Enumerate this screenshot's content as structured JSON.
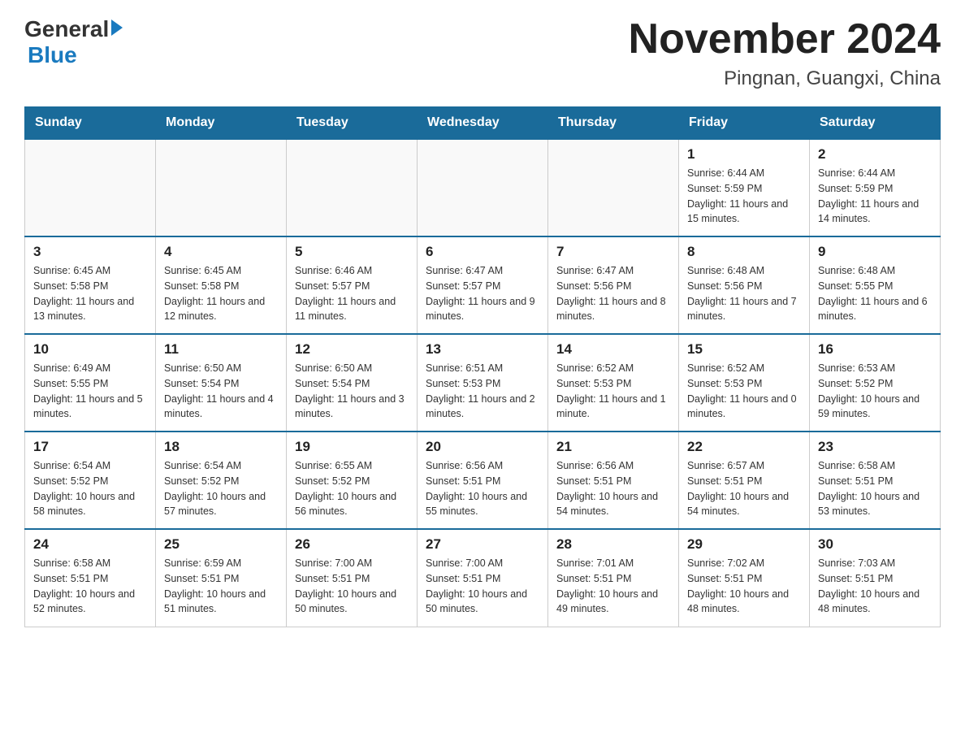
{
  "logo": {
    "text_general": "General",
    "text_blue": "Blue"
  },
  "title": "November 2024",
  "subtitle": "Pingnan, Guangxi, China",
  "weekdays": [
    "Sunday",
    "Monday",
    "Tuesday",
    "Wednesday",
    "Thursday",
    "Friday",
    "Saturday"
  ],
  "weeks": [
    [
      {
        "day": "",
        "info": ""
      },
      {
        "day": "",
        "info": ""
      },
      {
        "day": "",
        "info": ""
      },
      {
        "day": "",
        "info": ""
      },
      {
        "day": "",
        "info": ""
      },
      {
        "day": "1",
        "info": "Sunrise: 6:44 AM\nSunset: 5:59 PM\nDaylight: 11 hours\nand 15 minutes."
      },
      {
        "day": "2",
        "info": "Sunrise: 6:44 AM\nSunset: 5:59 PM\nDaylight: 11 hours\nand 14 minutes."
      }
    ],
    [
      {
        "day": "3",
        "info": "Sunrise: 6:45 AM\nSunset: 5:58 PM\nDaylight: 11 hours\nand 13 minutes."
      },
      {
        "day": "4",
        "info": "Sunrise: 6:45 AM\nSunset: 5:58 PM\nDaylight: 11 hours\nand 12 minutes."
      },
      {
        "day": "5",
        "info": "Sunrise: 6:46 AM\nSunset: 5:57 PM\nDaylight: 11 hours\nand 11 minutes."
      },
      {
        "day": "6",
        "info": "Sunrise: 6:47 AM\nSunset: 5:57 PM\nDaylight: 11 hours\nand 9 minutes."
      },
      {
        "day": "7",
        "info": "Sunrise: 6:47 AM\nSunset: 5:56 PM\nDaylight: 11 hours\nand 8 minutes."
      },
      {
        "day": "8",
        "info": "Sunrise: 6:48 AM\nSunset: 5:56 PM\nDaylight: 11 hours\nand 7 minutes."
      },
      {
        "day": "9",
        "info": "Sunrise: 6:48 AM\nSunset: 5:55 PM\nDaylight: 11 hours\nand 6 minutes."
      }
    ],
    [
      {
        "day": "10",
        "info": "Sunrise: 6:49 AM\nSunset: 5:55 PM\nDaylight: 11 hours\nand 5 minutes."
      },
      {
        "day": "11",
        "info": "Sunrise: 6:50 AM\nSunset: 5:54 PM\nDaylight: 11 hours\nand 4 minutes."
      },
      {
        "day": "12",
        "info": "Sunrise: 6:50 AM\nSunset: 5:54 PM\nDaylight: 11 hours\nand 3 minutes."
      },
      {
        "day": "13",
        "info": "Sunrise: 6:51 AM\nSunset: 5:53 PM\nDaylight: 11 hours\nand 2 minutes."
      },
      {
        "day": "14",
        "info": "Sunrise: 6:52 AM\nSunset: 5:53 PM\nDaylight: 11 hours\nand 1 minute."
      },
      {
        "day": "15",
        "info": "Sunrise: 6:52 AM\nSunset: 5:53 PM\nDaylight: 11 hours\nand 0 minutes."
      },
      {
        "day": "16",
        "info": "Sunrise: 6:53 AM\nSunset: 5:52 PM\nDaylight: 10 hours\nand 59 minutes."
      }
    ],
    [
      {
        "day": "17",
        "info": "Sunrise: 6:54 AM\nSunset: 5:52 PM\nDaylight: 10 hours\nand 58 minutes."
      },
      {
        "day": "18",
        "info": "Sunrise: 6:54 AM\nSunset: 5:52 PM\nDaylight: 10 hours\nand 57 minutes."
      },
      {
        "day": "19",
        "info": "Sunrise: 6:55 AM\nSunset: 5:52 PM\nDaylight: 10 hours\nand 56 minutes."
      },
      {
        "day": "20",
        "info": "Sunrise: 6:56 AM\nSunset: 5:51 PM\nDaylight: 10 hours\nand 55 minutes."
      },
      {
        "day": "21",
        "info": "Sunrise: 6:56 AM\nSunset: 5:51 PM\nDaylight: 10 hours\nand 54 minutes."
      },
      {
        "day": "22",
        "info": "Sunrise: 6:57 AM\nSunset: 5:51 PM\nDaylight: 10 hours\nand 54 minutes."
      },
      {
        "day": "23",
        "info": "Sunrise: 6:58 AM\nSunset: 5:51 PM\nDaylight: 10 hours\nand 53 minutes."
      }
    ],
    [
      {
        "day": "24",
        "info": "Sunrise: 6:58 AM\nSunset: 5:51 PM\nDaylight: 10 hours\nand 52 minutes."
      },
      {
        "day": "25",
        "info": "Sunrise: 6:59 AM\nSunset: 5:51 PM\nDaylight: 10 hours\nand 51 minutes."
      },
      {
        "day": "26",
        "info": "Sunrise: 7:00 AM\nSunset: 5:51 PM\nDaylight: 10 hours\nand 50 minutes."
      },
      {
        "day": "27",
        "info": "Sunrise: 7:00 AM\nSunset: 5:51 PM\nDaylight: 10 hours\nand 50 minutes."
      },
      {
        "day": "28",
        "info": "Sunrise: 7:01 AM\nSunset: 5:51 PM\nDaylight: 10 hours\nand 49 minutes."
      },
      {
        "day": "29",
        "info": "Sunrise: 7:02 AM\nSunset: 5:51 PM\nDaylight: 10 hours\nand 48 minutes."
      },
      {
        "day": "30",
        "info": "Sunrise: 7:03 AM\nSunset: 5:51 PM\nDaylight: 10 hours\nand 48 minutes."
      }
    ]
  ]
}
